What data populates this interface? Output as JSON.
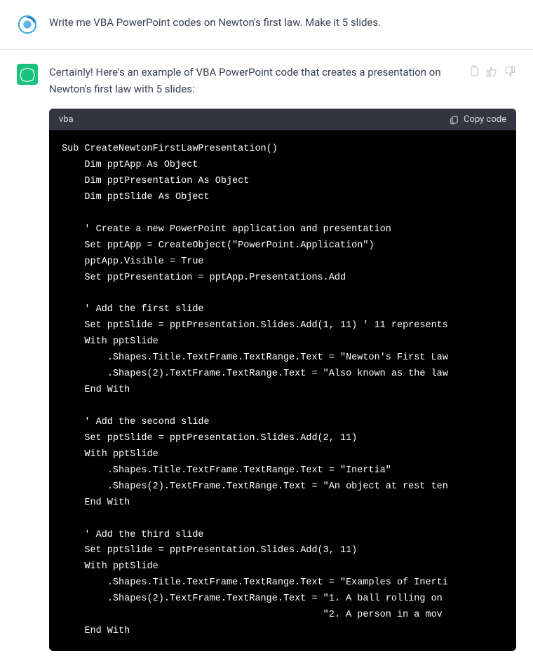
{
  "user_message": {
    "text": "Write me VBA PowerPoint codes on Newton's first law. Make it 5 slides."
  },
  "assistant_message": {
    "intro": "Certainly! Here's an example of VBA PowerPoint code that creates a presentation on Newton's first law with 5 slides:",
    "code": {
      "language": "vba",
      "copy_label": "Copy code",
      "content": "Sub CreateNewtonFirstLawPresentation()\n    Dim pptApp As Object\n    Dim pptPresentation As Object\n    Dim pptSlide As Object\n\n    ' Create a new PowerPoint application and presentation\n    Set pptApp = CreateObject(\"PowerPoint.Application\")\n    pptApp.Visible = True\n    Set pptPresentation = pptApp.Presentations.Add\n\n    ' Add the first slide\n    Set pptSlide = pptPresentation.Slides.Add(1, 11) ' 11 represents\n    With pptSlide\n        .Shapes.Title.TextFrame.TextRange.Text = \"Newton's First Law\n        .Shapes(2).TextFrame.TextRange.Text = \"Also known as the law\n    End With\n\n    ' Add the second slide\n    Set pptSlide = pptPresentation.Slides.Add(2, 11)\n    With pptSlide\n        .Shapes.Title.TextFrame.TextRange.Text = \"Inertia\"\n        .Shapes(2).TextFrame.TextRange.Text = \"An object at rest ten\n    End With\n\n    ' Add the third slide\n    Set pptSlide = pptPresentation.Slides.Add(3, 11)\n    With pptSlide\n        .Shapes.Title.TextFrame.TextRange.Text = \"Examples of Inerti\n        .Shapes(2).TextFrame.TextRange.Text = \"1. A ball rolling on \n                                              \"2. A person in a mov\n    End With"
    }
  }
}
